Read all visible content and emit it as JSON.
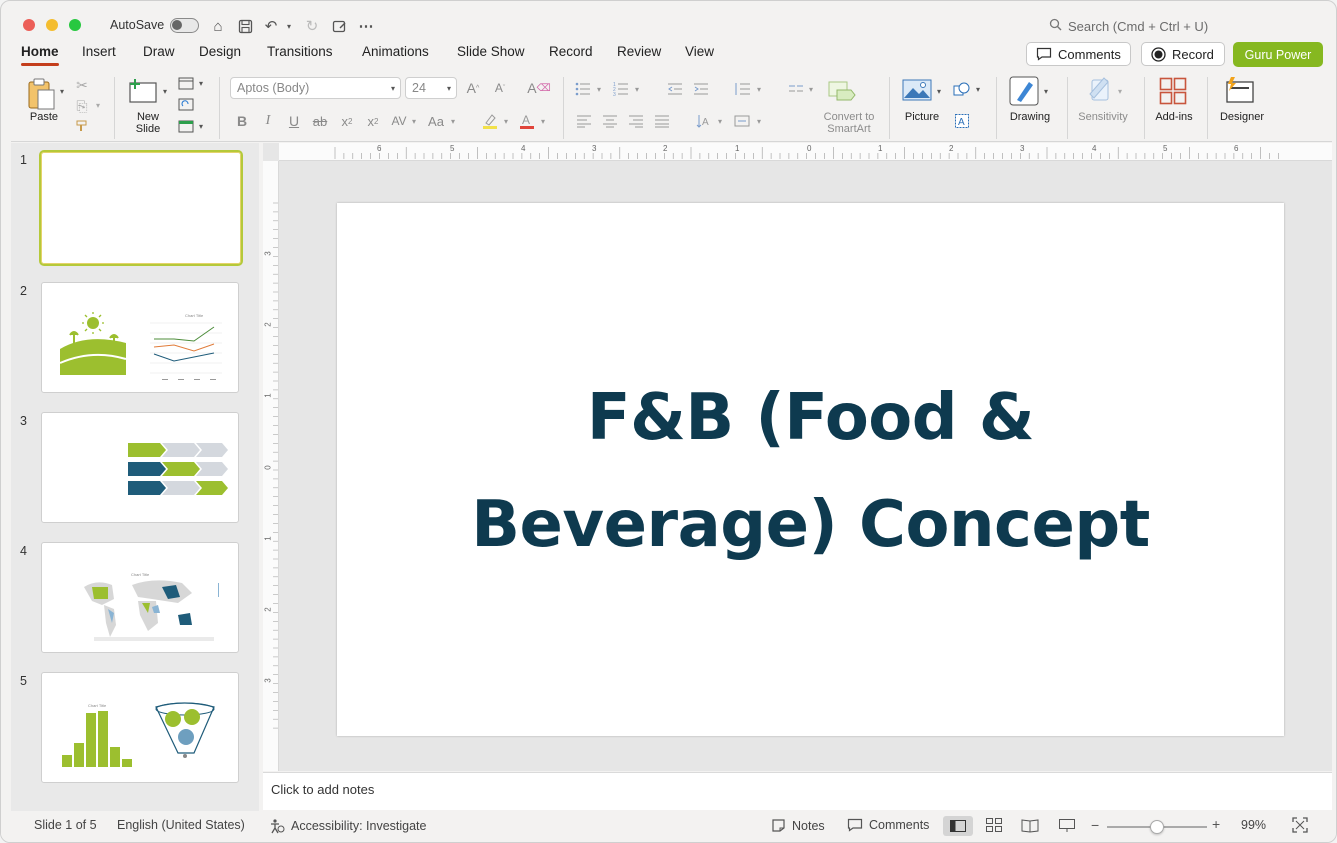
{
  "titlebar": {
    "autosave_label": "AutoSave",
    "search_placeholder": "Search (Cmd + Ctrl + U)"
  },
  "tabs": [
    "Home",
    "Insert",
    "Draw",
    "Design",
    "Transitions",
    "Animations",
    "Slide Show",
    "Record",
    "Review",
    "View"
  ],
  "active_tab": "Home",
  "header_buttons": {
    "comments": "Comments",
    "record": "Record",
    "guru": "Guru Power"
  },
  "ribbon": {
    "paste": "Paste",
    "new_slide": "New\nSlide",
    "font_name": "Aptos (Body)",
    "font_size": "24",
    "convert_smartart": "Convert to\nSmartArt",
    "picture": "Picture",
    "drawing": "Drawing",
    "sensitivity": "Sensitivity",
    "addins": "Add-ins",
    "designer": "Designer"
  },
  "slides_panel": {
    "numbers": [
      "1",
      "2",
      "3",
      "4",
      "5"
    ],
    "thumb2_chart_title": "Chart Title",
    "thumb4_chart_title": "Chart Title",
    "thumb5_chart_title": "Chart Title"
  },
  "ruler": {
    "h_ticks": [
      "6",
      "5",
      "4",
      "3",
      "2",
      "1",
      "0",
      "1",
      "2",
      "3",
      "4",
      "5",
      "6"
    ],
    "v_ticks": [
      "3",
      "2",
      "1",
      "0",
      "1",
      "2",
      "3"
    ]
  },
  "slide": {
    "title_line1": "F&B (Food &",
    "title_line2": "Beverage) Concept"
  },
  "notes": {
    "placeholder": "Click to add notes"
  },
  "status": {
    "slide_of": "Slide 1 of 5",
    "language": "English (United States)",
    "accessibility": "Accessibility: Investigate",
    "notes": "Notes",
    "comments": "Comments",
    "zoom": "99%",
    "zoom_level": 0.5
  },
  "colors": {
    "accent_red": "#c43e1c",
    "guru_green": "#86b820",
    "title_navy": "#0e3a4f",
    "thumb_green": "#9cbf2f",
    "thumb_blue": "#1f5c7a"
  }
}
